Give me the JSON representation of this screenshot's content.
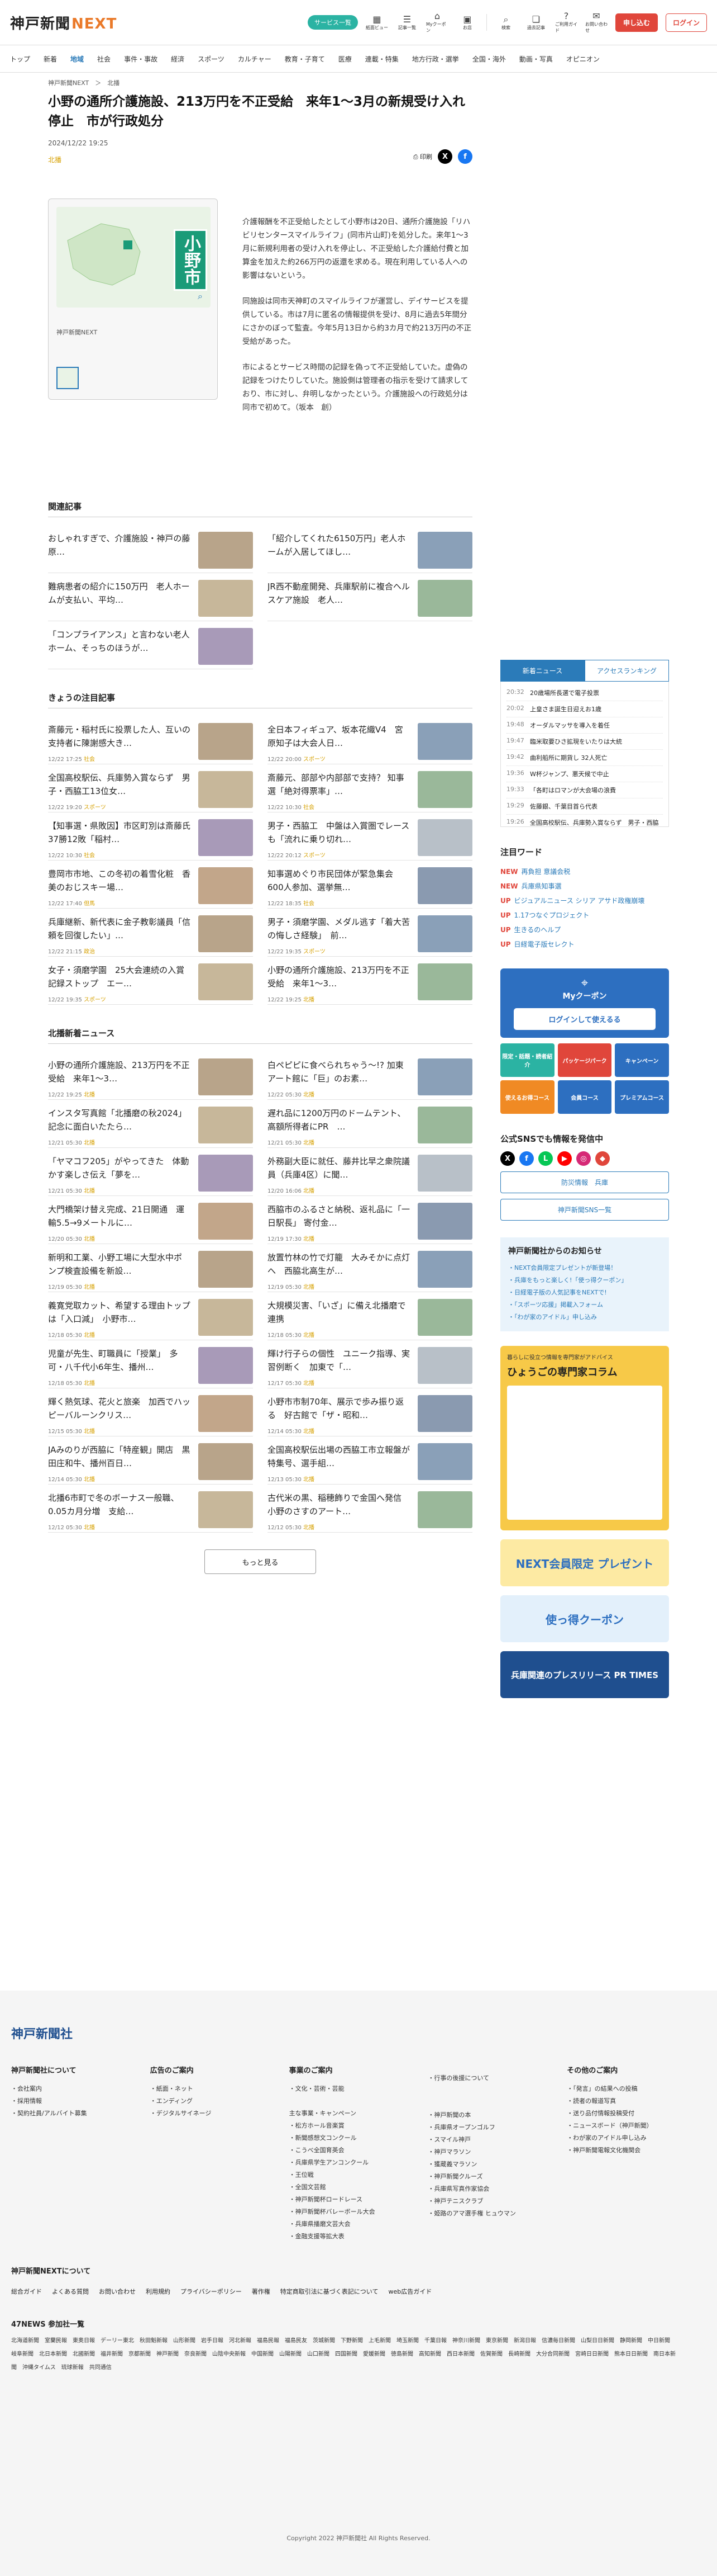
{
  "header": {
    "logo_main": "神戸新聞",
    "logo_next": "NEXT",
    "service_btn": "サービス一覧",
    "icons": [
      {
        "name": "paper-view-icon",
        "label": "紙面ビュー"
      },
      {
        "name": "list-icon",
        "label": "記事一覧"
      },
      {
        "name": "mycoupon-icon",
        "label": "Myクーポン"
      },
      {
        "name": "local-icon",
        "label": "お店"
      },
      {
        "name": "search-icon",
        "label": "検索"
      },
      {
        "name": "bookmark-icon",
        "label": "過去記事"
      },
      {
        "name": "guide-icon",
        "label": "ご利用ガイド"
      },
      {
        "name": "help-icon",
        "label": "お問い合わせ"
      }
    ],
    "signup": "申し込む",
    "login": "ログイン"
  },
  "nav": [
    "トップ",
    "新着",
    "地域",
    "社会",
    "事件・事故",
    "経済",
    "スポーツ",
    "カルチャー",
    "教育・子育て",
    "医療",
    "連載・特集",
    "地方行政・選挙",
    "全国・海外",
    "動画・写真",
    "オピニオン"
  ],
  "nav_active": "地域",
  "breadcrumb": "神戸新聞NEXT　＞　北播",
  "article": {
    "title": "小野の通所介護施設、213万円を不正受給　来年1～3月の新規受け入れ停止　市が行政処分",
    "date": "2024/12/22 19:25",
    "category": "北播",
    "print": "印刷",
    "map_label": "小野市",
    "map_caption": "神戸新聞NEXT",
    "paragraphs": [
      "介護報酬を不正受給したとして小野市は20日、通所介護施設「リハビリセンタースマイルライフ」(同市片山町)を処分した。来年1～3月に新規利用者の受け入れを停止し、不正受給した介護給付費と加算金を加えた約266万円の返還を求める。現在利用している人への影響はないという。",
      "同施設は同市天神町のスマイルライフが運営し、デイサービスを提供している。市は7月に匿名の情報提供を受け、8月に過去5年間分にさかのぼって監査。今年5月13日から約3カ月で約213万円の不正受給があった。",
      "市によるとサービス時間の記録を偽って不正受給していた。虚偽の記録をつけたりしていた。施設側は管理者の指示を受けて請求しており、市に対し、弁明しなかったという。介護施設への行政処分は同市で初めて。（坂本　創）"
    ]
  },
  "related": {
    "heading": "関連記事",
    "items": [
      {
        "title": "おしゃれすぎで、介護施設・神戸の藤原…"
      },
      {
        "title": "「紹介してくれた6150万円」老人ホームが入居してほし…"
      },
      {
        "title": "難病患者の紹介に150万円　老人ホームが支払い、平均…"
      },
      {
        "title": "JR西不動産開発、兵庫駅前に複合ヘルスケア施設　老人…"
      },
      {
        "title": "「コンプライアンス」と言わない老人ホーム、そっちのほうが…"
      }
    ]
  },
  "todays": {
    "heading": "きょうの注目記事",
    "items": [
      {
        "title": "斎藤元・稲村氏に投票した人、互いの支持者に陳謝感大き…",
        "meta": "12/22 17:25",
        "cat": "社会"
      },
      {
        "title": "全日本フィギュア、坂本花織V4　宮原知子は大会人日…",
        "meta": "12/22 20:00",
        "cat": "スポーツ"
      },
      {
        "title": "全国高校駅伝、兵庫勢入賞ならず　男子・西脇工13位女…",
        "meta": "12/22 19:20",
        "cat": "スポーツ"
      },
      {
        "title": "斎藤元、部部や内部部で支持？ 知事選「絶対得票率」…",
        "meta": "12/22 10:30",
        "cat": "社会"
      },
      {
        "title": "【知事選・県敗因】市区町別は斎藤氏37勝12敗「稲村…",
        "meta": "12/22 10:30",
        "cat": "社会"
      },
      {
        "title": "男子・西脇工　中盤は入賞圏でレースも「流れに乗り切れ…",
        "meta": "12/22 20:12",
        "cat": "スポーツ"
      },
      {
        "title": "豊岡市市地、この冬初の着雪化粧　香美のおじスキー場…",
        "meta": "12/22 17:40",
        "cat": "但馬"
      },
      {
        "title": "知事選めぐり市民団体が緊急集会　600人参加、選挙無…",
        "meta": "12/22 18:35",
        "cat": "社会"
      },
      {
        "title": "兵庫継新、新代表に金子教彰議員「信頼を回復したい」…",
        "meta": "12/22 21:15",
        "cat": "政治"
      },
      {
        "title": "男子・須磨学園、メダル逃す「着大苦の悔しさ経験」　前…",
        "meta": "12/22 19:35",
        "cat": "スポーツ"
      },
      {
        "title": "女子・須磨学園　25大会連続の入賞記録ストップ　エー…",
        "meta": "12/22 19:35",
        "cat": "スポーツ"
      },
      {
        "title": "小野の通所介護施設、213万円を不正受給　来年1～3…",
        "meta": "12/22 19:25",
        "cat": "北播"
      }
    ]
  },
  "hokuban": {
    "heading": "北播新着ニュース",
    "items": [
      {
        "title": "小野の通所介護施設、213万円を不正受給　来年1～3…",
        "meta": "12/22 19:25",
        "cat": "北播"
      },
      {
        "title": "白ペピピに食べられちゃう～!? 加東アート館に「巨」のお素…",
        "meta": "12/22 05:30",
        "cat": "北播"
      },
      {
        "title": "インスタ写真館「北播磨の秋2024」　記念に面白いたたら…",
        "meta": "12/21 05:30",
        "cat": "北播"
      },
      {
        "title": "遅れ品に1200万円のドームテント、高額所得者にPR　…",
        "meta": "12/21 05:30",
        "cat": "北播"
      },
      {
        "title": "「ヤマコフ205」がやってきた　体動かす楽しさ伝え「夢を…",
        "meta": "12/21 05:30",
        "cat": "北播"
      },
      {
        "title": "外務副大臣に就任、藤井比早之衆院議員（兵庫4区）に聞…",
        "meta": "12/20 16:06",
        "cat": "北播"
      },
      {
        "title": "大門橋架け替え完成、21日開通　運輸5.5→9メートルに…",
        "meta": "12/20 05:30",
        "cat": "北播"
      },
      {
        "title": "西脇市のふるさと納税、返礼品に「一日駅長」 寄付金…",
        "meta": "12/19 17:30",
        "cat": "北播"
      },
      {
        "title": "新明和工業、小野工場に大型水中ポンプ検査設備を新設…",
        "meta": "12/19 05:30",
        "cat": "北播"
      },
      {
        "title": "放置竹林の竹で灯籠　大みそかに点灯へ　西脇北高生が…",
        "meta": "12/19 05:30",
        "cat": "北播"
      },
      {
        "title": "義寛党取カット、希望する理由トップは「入口減」　小野市…",
        "meta": "12/18 05:30",
        "cat": "北播"
      },
      {
        "title": "大規模災害、「いざ」に備え北播磨で連携",
        "meta": "12/18 05:30",
        "cat": "北播"
      },
      {
        "title": "児童が先生、町職員に「授業」　多可・八千代小6年生、播州…",
        "meta": "12/18 05:30",
        "cat": "北播"
      },
      {
        "title": "輝け行子らの個性　ユニーク指導、実習例断く　加東で「…",
        "meta": "12/17 05:30",
        "cat": "北播"
      },
      {
        "title": "輝く熱気球、花火と旅楽　加西でハッピーバルーンクリス…",
        "meta": "12/15 05:30",
        "cat": "北播"
      },
      {
        "title": "小野市市制70年、展示で歩み振り返る　好古館で「ザ・昭和…",
        "meta": "12/14 05:30",
        "cat": "北播"
      },
      {
        "title": "JAみのりが西脇に「特産観」開店　黒田庄和牛、播州百日…",
        "meta": "12/14 05:30",
        "cat": "北播"
      },
      {
        "title": "全国高校駅伝出場の西脇工市立報盤が特集号、選手組…",
        "meta": "12/13 05:30",
        "cat": "北播"
      },
      {
        "title": "北播6市町で冬のボーナス一般職、0.05カ月分増　支給…",
        "meta": "12/12 05:30",
        "cat": "北播"
      },
      {
        "title": "古代米の黒、稲穂飾りで金国へ発信　小野のさすのアート…",
        "meta": "12/12 05:30",
        "cat": "北播"
      }
    ],
    "more": "もっと見る"
  },
  "sidebar": {
    "tabs": [
      "新着ニュース",
      "アクセスランキング"
    ],
    "news": [
      {
        "t": "20:32",
        "title": "20歳場所長選で電子投票"
      },
      {
        "t": "20:02",
        "title": "上皇さま誕生日迎えお1歳"
      },
      {
        "t": "19:48",
        "title": "オーダルマッサを導入を着任"
      },
      {
        "t": "19:47",
        "title": "臨米取要ひさ拡現をいたりは大統"
      },
      {
        "t": "19:42",
        "title": "曲利船所に期貨し 32人死亡"
      },
      {
        "t": "19:36",
        "title": "W杯ジャンプ、悪天候で中止"
      },
      {
        "t": "19:33",
        "title": "「各町はロマンが大会場の浪費"
      },
      {
        "t": "19:29",
        "title": "佐藤銀、千葉目首ら代表"
      },
      {
        "t": "19:26",
        "title": "全国高校駅伝、兵庫勢入賞ならず　男子・西脇工13位女 須磨学園は7位"
      },
      {
        "t": "19:25",
        "title": "島田崇典 中田博士代表"
      }
    ],
    "hot_heading": "注目ワード",
    "hot": [
      {
        "tag": "NEW",
        "word": "再負担 意議会税"
      },
      {
        "tag": "NEW",
        "word": "兵庫県知事選"
      },
      {
        "tag": "UP",
        "word": "ビジュアルニュース シリア アサド政権崩壊"
      },
      {
        "tag": "UP",
        "word": "1.17つなぐプロジェクト"
      },
      {
        "tag": "UP",
        "word": "生きるのヘルプ"
      },
      {
        "tag": "UP",
        "word": "日経電子版セレクト"
      }
    ],
    "mycoupon_title": "Myクーポン",
    "mycoupon_btn": "ログインして使えるる",
    "promo": [
      "限定・話題・読者紹介",
      "パッケージパーク",
      "キャンペーン",
      "使えるお得コース",
      "会員コース",
      "プレミアムコース"
    ],
    "sns_heading": "公式SNSでも情報を発信中",
    "sns_btn1": "防災情報　兵庫",
    "sns_btn2": "神戸新聞SNS一覧",
    "notice_heading": "神戸新聞社からのお知らせ",
    "notice": [
      "・NEXT会員限定プレゼントが新登場！",
      "・兵庫をもっと楽しく!「使っ得クーポン」",
      "・日経電子版の人気記事をNEXTで!",
      "・「スポーツ応援」掲載入フォーム",
      "・「わが家のアイドル」申し込み"
    ],
    "column_title": "ひょうごの専門家コラム",
    "column_sub": "暮らしに役立つ情報を専門家がアドバイス",
    "banner1": "NEXT会員限定 プレゼント",
    "banner2": "使っ得クーポン",
    "banner3": "兵庫関連のプレスリリース PR TIMES"
  },
  "footer": {
    "logo": "神戸新聞社",
    "cols": [
      {
        "h": "神戸新聞社について",
        "items": [
          "・会社案内",
          "・採用情報",
          "・契約社員/アルバイト募集"
        ]
      },
      {
        "h": "広告のご案内",
        "items": [
          "・紙面・ネット",
          "・エンディング",
          "・デジタルサイネージ"
        ]
      },
      {
        "h": "事業のご案内",
        "items": [
          "・文化・芸術・芸能",
          "",
          "主な事業・キャンペーン",
          "・松方ホール音楽賞",
          "・新聞感想文コンクール",
          "・こうべ全国育英会",
          "・兵庫県学生アンコンクール",
          "・王位戦",
          "・全国文芸館",
          "・神戸新聞杯ロードレース",
          "・神戸新聞杯バレーボール大会",
          "・兵庫県播磨文芸大会",
          "・金融支援等拡大表"
        ]
      },
      {
        "h": "",
        "items": [
          "・行事の後援について",
          "",
          "",
          "・神戸新聞の本",
          "・兵庫県オープンゴルフ",
          "・スマイル神戸",
          "・神戸マラソン",
          "・獲蔵義マラソン",
          "・神戸新聞クルーズ",
          "・兵庫県写真作家協会",
          "・神戸テニスクラブ",
          "・姫路のアマ選手権 ヒュウマン"
        ]
      },
      {
        "h": "その他のご案内",
        "items": [
          "・「発言」の結果への投稿",
          "・読者の報道写真",
          "・送り品付情報投稿受付",
          "・ニュースボード（神戸新聞）",
          "・わが家のアイドル申し込み",
          "・神戸新聞電報文化機関会"
        ]
      }
    ],
    "next_heading": "神戸新聞NEXTについて",
    "links": [
      "総合ガイド",
      "よくある質問",
      "お問い合わせ",
      "利用規約",
      "プライバシーポリシー",
      "著作権",
      "特定商取引法に基づく表記について",
      "web広告ガイド"
    ],
    "news47": "47NEWS 参加社一覧",
    "pref": "北海道新聞　室蘭民報　東奥日報　デーリー東北　秋田魁新報　山形新聞　岩手日報　河北新報　福島民報　福島民友　茨城新聞　下野新聞　上毛新聞　埼玉新聞　千葉日報　神奈川新聞　東京新聞　新潟日報　信濃毎日新聞　山梨日日新聞　静岡新聞　中日新聞　岐阜新聞　北日本新聞　北國新聞　福井新聞　京都新聞　神戸新聞　奈良新聞　山陰中央新報　中国新聞　山陽新聞　山口新聞　四国新聞　愛媛新聞　徳島新聞　高知新聞　西日本新聞　佐賀新聞　長崎新聞　大分合同新聞　宮崎日日新聞　熊本日日新聞　南日本新聞　沖縄タイムス　琉球新報　共同通信",
    "copyright": "Copyright 2022 神戸新聞社 All Rights Reserved."
  }
}
